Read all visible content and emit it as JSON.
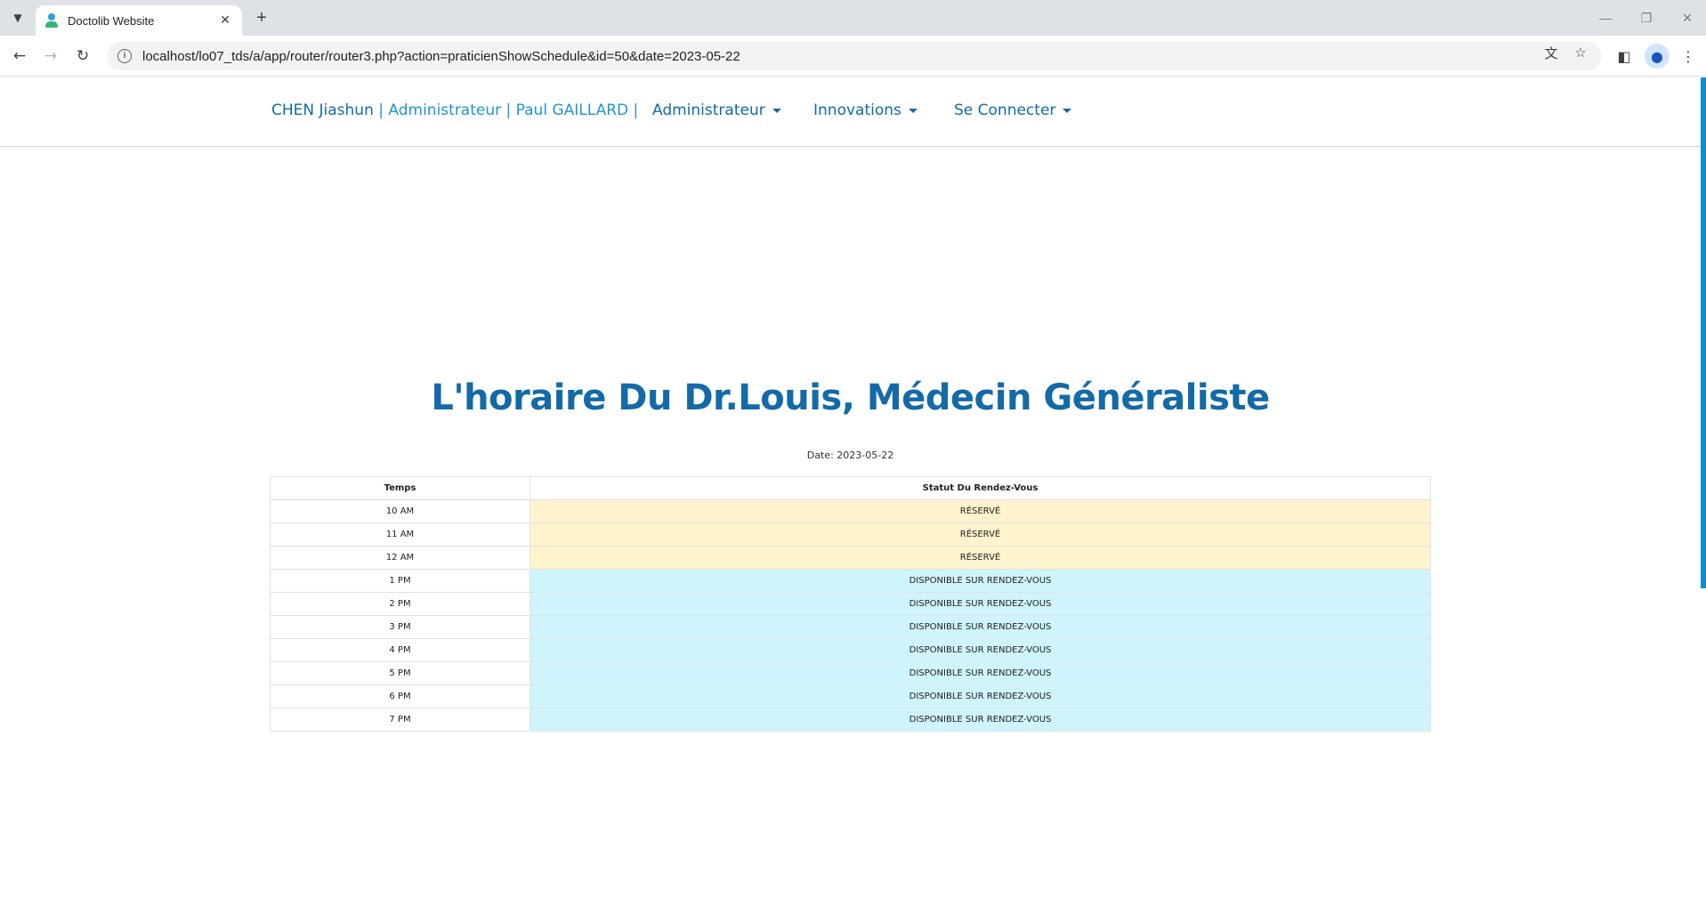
{
  "browser": {
    "tab_title": "Doctolib Website",
    "url": "localhost/lo07_tds/a/app/router/router3.php?action=praticienShowSchedule&id=50&date=2023-05-22"
  },
  "nav": {
    "brand_name": "CHEN Jiashun",
    "brand_rest": "| Administrateur | Paul GAILLARD |",
    "menus": [
      "Administrateur",
      "Innovations",
      "Se Connecter"
    ]
  },
  "main": {
    "title": "L'horaire Du Dr.Louis, Médecin Généraliste",
    "date_label": "Date: 2023-05-22"
  },
  "schedule": {
    "headers": [
      "Temps",
      "Statut Du Rendez-Vous"
    ],
    "rows": [
      {
        "time": "10 AM",
        "status": "RÉSERVÉ",
        "kind": "reserved"
      },
      {
        "time": "11 AM",
        "status": "RÉSERVÉ",
        "kind": "reserved"
      },
      {
        "time": "12 AM",
        "status": "RÉSERVÉ",
        "kind": "reserved"
      },
      {
        "time": "1 PM",
        "status": "DISPONIBLE SUR RENDEZ-VOUS",
        "kind": "available"
      },
      {
        "time": "2 PM",
        "status": "DISPONIBLE SUR RENDEZ-VOUS",
        "kind": "available"
      },
      {
        "time": "3 PM",
        "status": "DISPONIBLE SUR RENDEZ-VOUS",
        "kind": "available"
      },
      {
        "time": "4 PM",
        "status": "DISPONIBLE SUR RENDEZ-VOUS",
        "kind": "available"
      },
      {
        "time": "5 PM",
        "status": "DISPONIBLE SUR RENDEZ-VOUS",
        "kind": "available"
      },
      {
        "time": "6 PM",
        "status": "DISPONIBLE SUR RENDEZ-VOUS",
        "kind": "available"
      },
      {
        "time": "7 PM",
        "status": "DISPONIBLE SUR RENDEZ-VOUS",
        "kind": "available"
      }
    ]
  },
  "colors": {
    "primary": "#146aa8",
    "brand_light": "#1f95d1",
    "reserved_bg": "#fff3cd",
    "available_bg": "#cff4fc"
  },
  "icons": {
    "tab_search": "chevron-down-icon",
    "favicon": "doctor-icon",
    "tab_close": "close-icon",
    "new_tab": "plus-icon",
    "back": "arrow-left-icon",
    "forward": "arrow-right-icon",
    "reload": "reload-icon",
    "site_info": "info-icon",
    "translate": "translate-icon",
    "bookmark": "star-icon",
    "side_panel": "side-panel-icon",
    "profile": "profile-icon",
    "menu": "kebab-menu-icon"
  }
}
